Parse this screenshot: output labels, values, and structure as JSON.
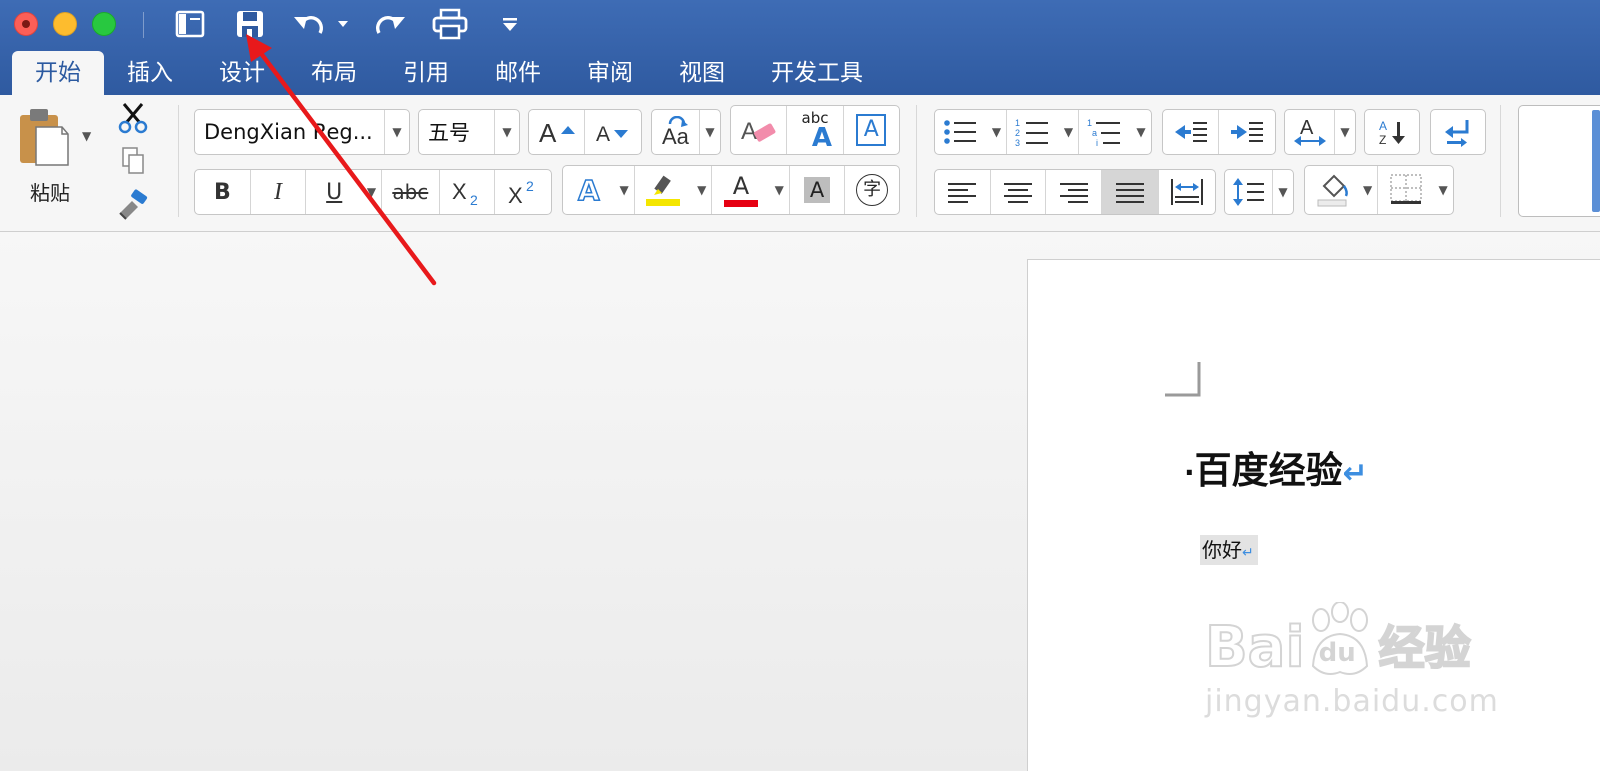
{
  "window": {
    "controls": [
      "close",
      "minimize",
      "maximize"
    ]
  },
  "quick_access": [
    "sidebar-toggle-icon",
    "save-icon",
    "undo-icon",
    "redo-icon",
    "print-icon",
    "customize-icon"
  ],
  "tabs": [
    "开始",
    "插入",
    "设计",
    "布局",
    "引用",
    "邮件",
    "审阅",
    "视图",
    "开发工具"
  ],
  "active_tab": "开始",
  "ribbon": {
    "paste_label": "粘贴",
    "font_name": "DengXian Reg...",
    "font_size": "五号",
    "bold": "B",
    "italic": "I",
    "underline": "U",
    "strikethrough": "abc",
    "spell_abc": "abc",
    "phonetic_char": "字",
    "font_color_letter": "A",
    "highlight_color": "#f4e600",
    "font_color": "#e60012"
  },
  "document": {
    "heading": "百度经验",
    "paragraph": "你好",
    "return_mark": "↵"
  },
  "watermark": {
    "brand": "Bai",
    "brand_tail": "经验",
    "brand_du": "du",
    "url": "jingyan.baidu.com"
  },
  "colors": {
    "title_bar": "#2f5aa0",
    "accent": "#2c5aa0",
    "annotation_arrow": "#e8191b",
    "paragraph_mark": "#3d8ee0"
  }
}
